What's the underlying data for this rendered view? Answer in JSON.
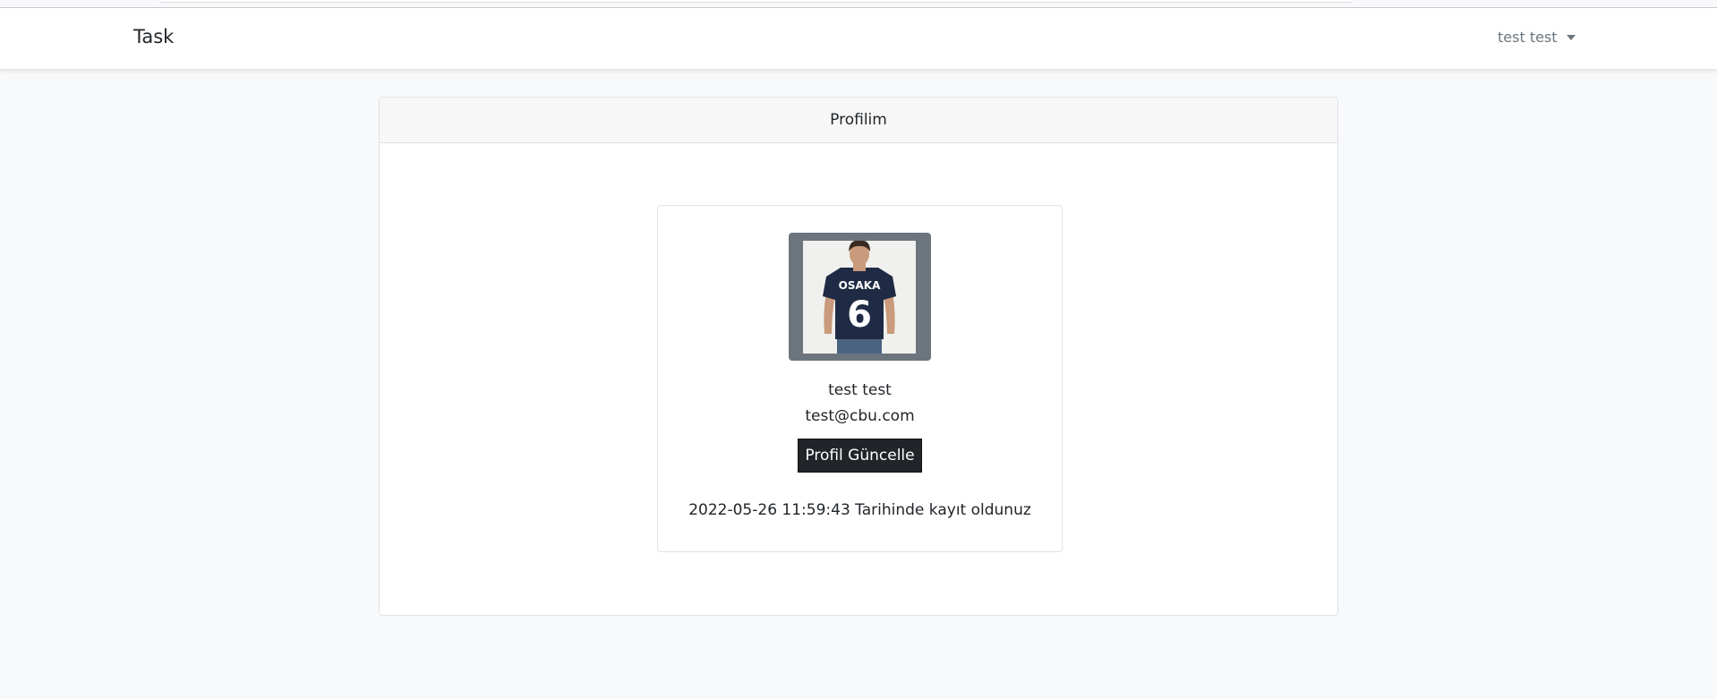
{
  "navbar": {
    "brand": "Task",
    "user_menu_label": "test test"
  },
  "card": {
    "header": "Profilim"
  },
  "profile": {
    "name": "test test",
    "email": "test@cbu.com",
    "update_button": "Profil Güncelle",
    "registered_text": "2022-05-26 11:59:43 Tarihinde kayıt oldunuz",
    "shirt_text": "OSAKA",
    "shirt_number": "6"
  }
}
